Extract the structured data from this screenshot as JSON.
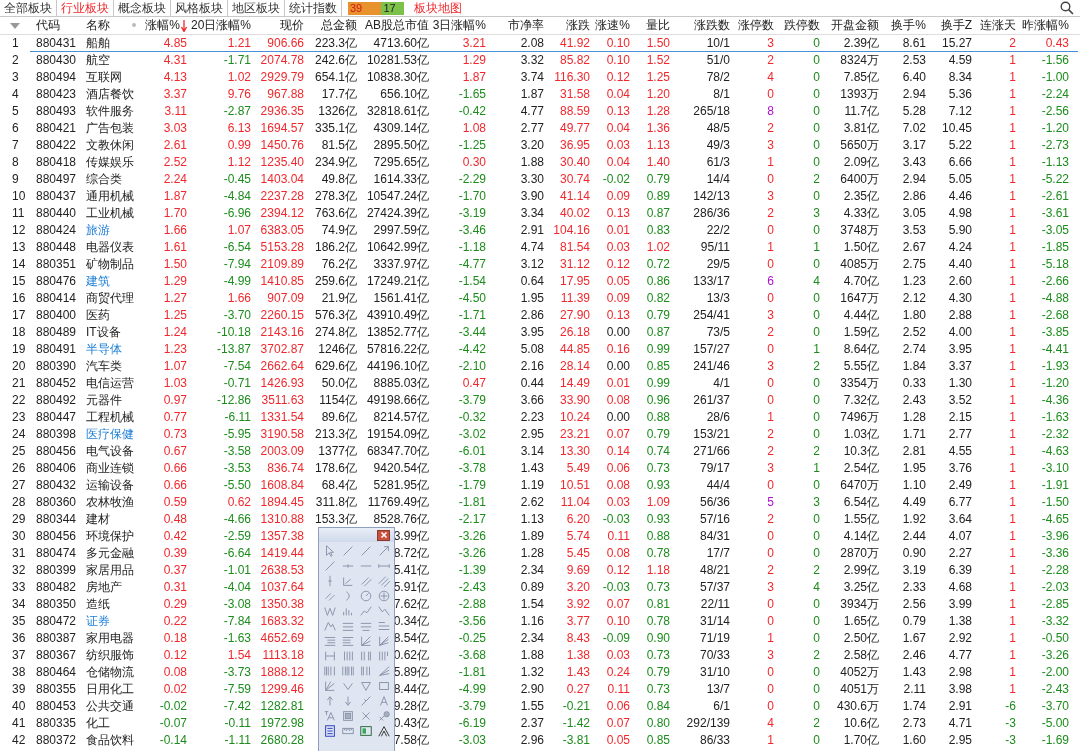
{
  "tabs": [
    {
      "label": "全部板块",
      "selected": false
    },
    {
      "label": "行业板块",
      "selected": true
    },
    {
      "label": "概念板块",
      "selected": false
    },
    {
      "label": "风格板块",
      "selected": false
    },
    {
      "label": "地区板块",
      "selected": false
    },
    {
      "label": "统计指数",
      "selected": false
    }
  ],
  "breadth": {
    "up": "39",
    "down": "17"
  },
  "map_link": "板块地图",
  "columns": [
    {
      "kind": "index"
    },
    {
      "kind": "code",
      "label": "代码",
      "sorted": false
    },
    {
      "kind": "name",
      "label": "名称",
      "sorted": false
    },
    {
      "kind": "change",
      "label": "涨幅%",
      "sorted": true
    },
    {
      "kind": "signed",
      "label": "20日涨幅%",
      "sorted": false
    },
    {
      "kind": "price",
      "label": "现价",
      "sorted": false
    },
    {
      "kind": "plain",
      "label": "总金额",
      "sorted": false
    },
    {
      "kind": "plain",
      "label": "AB股总市值",
      "sorted": false
    },
    {
      "kind": "signed",
      "label": "3日涨幅%",
      "sorted": false
    },
    {
      "kind": "plain",
      "label": "市净率",
      "sorted": false
    },
    {
      "kind": "signed",
      "label": "涨跌",
      "sorted": false
    },
    {
      "kind": "signed",
      "label": "涨速%",
      "sorted": false
    },
    {
      "kind": "ratio",
      "label": "量比",
      "sorted": false
    },
    {
      "kind": "plain",
      "label": "涨跌数",
      "sorted": false
    },
    {
      "kind": "limit_up",
      "label": "涨停数",
      "sorted": false
    },
    {
      "kind": "limit_down",
      "label": "跌停数",
      "sorted": false
    },
    {
      "kind": "plain",
      "label": "开盘金额",
      "sorted": false
    },
    {
      "kind": "plain",
      "label": "换手%",
      "sorted": false
    },
    {
      "kind": "plain",
      "label": "换手Z",
      "sorted": false
    },
    {
      "kind": "signed",
      "label": "连涨天",
      "sorted": false
    },
    {
      "kind": "signed",
      "label": "昨涨幅%",
      "sorted": false
    }
  ],
  "rows": [
    {
      "selected": true,
      "marked": false,
      "cells": [
        "1",
        "880431",
        "船舶",
        "4.85",
        "1.21",
        "906.66",
        "223.3亿",
        "4713.60亿",
        "3.21",
        "2.08",
        "41.92",
        "0.10",
        "1.50",
        "10/1",
        "3",
        "0",
        "2.39亿",
        "8.61",
        "15.27",
        "2",
        "0.43"
      ]
    },
    {
      "selected": false,
      "marked": false,
      "cells": [
        "2",
        "880430",
        "航空",
        "4.31",
        "-1.71",
        "2074.78",
        "242.6亿",
        "10281.53亿",
        "1.29",
        "3.32",
        "85.82",
        "0.10",
        "1.52",
        "51/0",
        "2",
        "0",
        "8324万",
        "2.53",
        "4.59",
        "1",
        "-1.56"
      ]
    },
    {
      "selected": false,
      "marked": false,
      "cells": [
        "3",
        "880494",
        "互联网",
        "4.13",
        "1.02",
        "2929.79",
        "654.1亿",
        "10838.30亿",
        "1.87",
        "3.74",
        "116.30",
        "0.12",
        "1.25",
        "78/2",
        "4",
        "0",
        "7.85亿",
        "6.40",
        "8.34",
        "1",
        "-1.00"
      ]
    },
    {
      "selected": false,
      "marked": false,
      "cells": [
        "4",
        "880423",
        "酒店餐饮",
        "3.37",
        "9.76",
        "967.88",
        "17.7亿",
        "656.10亿",
        "-1.65",
        "1.87",
        "31.58",
        "0.04",
        "1.20",
        "8/1",
        "0",
        "0",
        "1393万",
        "2.94",
        "5.36",
        "1",
        "-2.24"
      ]
    },
    {
      "selected": false,
      "marked": false,
      "cells": [
        "5",
        "880493",
        "软件服务",
        "3.11",
        "-2.87",
        "2936.35",
        "1326亿",
        "32818.61亿",
        "-0.42",
        "4.77",
        "88.59",
        "0.13",
        "1.28",
        "265/18",
        "8",
        "0",
        "11.7亿",
        "5.28",
        "7.12",
        "1",
        "-2.56"
      ]
    },
    {
      "selected": false,
      "marked": false,
      "cells": [
        "6",
        "880421",
        "广告包装",
        "3.03",
        "6.13",
        "1694.57",
        "335.1亿",
        "4309.14亿",
        "1.08",
        "2.77",
        "49.77",
        "0.04",
        "1.36",
        "48/5",
        "2",
        "0",
        "3.81亿",
        "7.02",
        "10.45",
        "1",
        "-1.20"
      ]
    },
    {
      "selected": false,
      "marked": false,
      "cells": [
        "7",
        "880422",
        "文教休闲",
        "2.61",
        "0.99",
        "1450.76",
        "81.5亿",
        "2895.50亿",
        "-1.25",
        "3.20",
        "36.95",
        "0.03",
        "1.13",
        "49/3",
        "3",
        "0",
        "5650万",
        "3.17",
        "5.22",
        "1",
        "-2.73"
      ]
    },
    {
      "selected": false,
      "marked": false,
      "cells": [
        "8",
        "880418",
        "传媒娱乐",
        "2.52",
        "1.12",
        "1235.40",
        "234.9亿",
        "7295.65亿",
        "0.30",
        "1.88",
        "30.40",
        "0.04",
        "1.40",
        "61/3",
        "1",
        "0",
        "2.09亿",
        "3.43",
        "6.66",
        "1",
        "-1.13"
      ]
    },
    {
      "selected": false,
      "marked": false,
      "cells": [
        "9",
        "880497",
        "综合类",
        "2.24",
        "-0.45",
        "1403.04",
        "49.8亿",
        "1614.33亿",
        "-2.29",
        "3.30",
        "30.74",
        "-0.02",
        "0.79",
        "14/4",
        "0",
        "2",
        "6400万",
        "2.94",
        "5.05",
        "1",
        "-5.22"
      ]
    },
    {
      "selected": false,
      "marked": false,
      "cells": [
        "10",
        "880437",
        "通用机械",
        "1.87",
        "-4.84",
        "2237.28",
        "278.3亿",
        "10547.24亿",
        "-1.70",
        "3.90",
        "41.14",
        "0.09",
        "0.89",
        "142/13",
        "3",
        "0",
        "2.35亿",
        "2.86",
        "4.46",
        "1",
        "-2.61"
      ]
    },
    {
      "selected": false,
      "marked": false,
      "cells": [
        "11",
        "880440",
        "工业机械",
        "1.70",
        "-6.96",
        "2394.12",
        "763.6亿",
        "27424.39亿",
        "-3.19",
        "3.34",
        "40.02",
        "0.13",
        "0.87",
        "286/36",
        "2",
        "3",
        "4.33亿",
        "3.05",
        "4.98",
        "1",
        "-3.61"
      ]
    },
    {
      "selected": false,
      "marked": true,
      "cells": [
        "12",
        "880424",
        "旅游",
        "1.66",
        "1.07",
        "6383.05",
        "74.9亿",
        "2997.59亿",
        "-3.46",
        "2.91",
        "104.16",
        "0.01",
        "0.83",
        "22/2",
        "0",
        "0",
        "3748万",
        "3.53",
        "5.90",
        "1",
        "-3.05"
      ]
    },
    {
      "selected": false,
      "marked": false,
      "cells": [
        "13",
        "880448",
        "电器仪表",
        "1.61",
        "-6.54",
        "5153.28",
        "186.2亿",
        "10642.99亿",
        "-1.18",
        "4.74",
        "81.54",
        "0.03",
        "1.02",
        "95/11",
        "1",
        "1",
        "1.50亿",
        "2.67",
        "4.24",
        "1",
        "-1.85"
      ]
    },
    {
      "selected": false,
      "marked": false,
      "cells": [
        "14",
        "880351",
        "矿物制品",
        "1.50",
        "-7.94",
        "2109.89",
        "76.2亿",
        "3337.97亿",
        "-4.77",
        "3.12",
        "31.12",
        "0.12",
        "0.72",
        "29/5",
        "0",
        "0",
        "4085万",
        "2.75",
        "4.40",
        "1",
        "-5.18"
      ]
    },
    {
      "selected": false,
      "marked": true,
      "cells": [
        "15",
        "880476",
        "建筑",
        "1.29",
        "-4.99",
        "1410.85",
        "259.6亿",
        "17249.21亿",
        "-1.54",
        "0.64",
        "17.95",
        "0.05",
        "0.86",
        "133/17",
        "6",
        "4",
        "4.70亿",
        "1.23",
        "2.60",
        "1",
        "-2.66"
      ]
    },
    {
      "selected": false,
      "marked": false,
      "cells": [
        "16",
        "880414",
        "商贸代理",
        "1.27",
        "1.66",
        "907.09",
        "21.9亿",
        "1561.41亿",
        "-4.50",
        "1.95",
        "11.39",
        "0.09",
        "0.82",
        "13/3",
        "0",
        "0",
        "1647万",
        "2.12",
        "4.30",
        "1",
        "-4.88"
      ]
    },
    {
      "selected": false,
      "marked": false,
      "cells": [
        "17",
        "880400",
        "医药",
        "1.25",
        "-3.70",
        "2260.15",
        "576.3亿",
        "43910.49亿",
        "-1.71",
        "2.86",
        "27.90",
        "0.13",
        "0.79",
        "254/41",
        "3",
        "0",
        "4.44亿",
        "1.80",
        "2.88",
        "1",
        "-2.68"
      ]
    },
    {
      "selected": false,
      "marked": false,
      "cells": [
        "18",
        "880489",
        "IT设备",
        "1.24",
        "-10.18",
        "2143.16",
        "274.8亿",
        "13852.77亿",
        "-3.44",
        "3.95",
        "26.18",
        "0.00",
        "0.87",
        "73/5",
        "2",
        "0",
        "1.59亿",
        "2.52",
        "4.00",
        "1",
        "-3.85"
      ]
    },
    {
      "selected": false,
      "marked": true,
      "cells": [
        "19",
        "880491",
        "半导体",
        "1.23",
        "-13.87",
        "3702.87",
        "1246亿",
        "57816.22亿",
        "-4.42",
        "5.08",
        "44.85",
        "0.16",
        "0.99",
        "157/27",
        "0",
        "1",
        "8.64亿",
        "2.74",
        "3.95",
        "1",
        "-4.41"
      ]
    },
    {
      "selected": false,
      "marked": false,
      "cells": [
        "20",
        "880390",
        "汽车类",
        "1.07",
        "-7.54",
        "2662.64",
        "629.6亿",
        "44196.10亿",
        "-2.10",
        "2.16",
        "28.14",
        "0.00",
        "0.85",
        "241/46",
        "3",
        "2",
        "5.55亿",
        "1.84",
        "3.37",
        "1",
        "-1.93"
      ]
    },
    {
      "selected": false,
      "marked": false,
      "cells": [
        "21",
        "880452",
        "电信运营",
        "1.03",
        "-0.71",
        "1426.93",
        "50.0亿",
        "8885.03亿",
        "0.47",
        "0.44",
        "14.49",
        "0.01",
        "0.99",
        "4/1",
        "0",
        "0",
        "3354万",
        "0.33",
        "1.30",
        "1",
        "-1.20"
      ]
    },
    {
      "selected": false,
      "marked": false,
      "cells": [
        "22",
        "880492",
        "元器件",
        "0.97",
        "-12.86",
        "3511.63",
        "1154亿",
        "49198.66亿",
        "-3.79",
        "3.66",
        "33.90",
        "0.08",
        "0.96",
        "261/37",
        "0",
        "0",
        "7.32亿",
        "2.43",
        "3.52",
        "1",
        "-4.36"
      ]
    },
    {
      "selected": false,
      "marked": false,
      "cells": [
        "23",
        "880447",
        "工程机械",
        "0.77",
        "-6.11",
        "1331.54",
        "89.6亿",
        "8214.57亿",
        "-0.32",
        "2.23",
        "10.24",
        "0.00",
        "0.88",
        "28/6",
        "1",
        "0",
        "7496万",
        "1.28",
        "2.15",
        "1",
        "-1.63"
      ]
    },
    {
      "selected": false,
      "marked": true,
      "cells": [
        "24",
        "880398",
        "医疗保健",
        "0.73",
        "-5.95",
        "3190.58",
        "213.3亿",
        "19154.09亿",
        "-3.02",
        "2.95",
        "23.21",
        "0.07",
        "0.79",
        "153/21",
        "2",
        "0",
        "1.03亿",
        "1.71",
        "2.77",
        "1",
        "-2.32"
      ]
    },
    {
      "selected": false,
      "marked": false,
      "cells": [
        "25",
        "880456",
        "电气设备",
        "0.67",
        "-3.58",
        "2003.09",
        "1377亿",
        "68347.70亿",
        "-6.01",
        "3.14",
        "13.30",
        "0.14",
        "0.74",
        "271/66",
        "2",
        "2",
        "10.3亿",
        "2.81",
        "4.55",
        "1",
        "-4.63"
      ]
    },
    {
      "selected": false,
      "marked": false,
      "cells": [
        "26",
        "880406",
        "商业连锁",
        "0.66",
        "-3.53",
        "836.74",
        "178.6亿",
        "9420.54亿",
        "-3.78",
        "1.43",
        "5.49",
        "0.06",
        "0.73",
        "79/17",
        "3",
        "1",
        "2.54亿",
        "1.95",
        "3.76",
        "1",
        "-3.10"
      ]
    },
    {
      "selected": false,
      "marked": false,
      "cells": [
        "27",
        "880432",
        "运输设备",
        "0.66",
        "-5.50",
        "1608.84",
        "68.4亿",
        "5281.95亿",
        "-1.79",
        "1.19",
        "10.51",
        "0.08",
        "0.93",
        "44/4",
        "0",
        "0",
        "6470万",
        "1.10",
        "2.49",
        "1",
        "-1.91"
      ]
    },
    {
      "selected": false,
      "marked": false,
      "cells": [
        "28",
        "880360",
        "农林牧渔",
        "0.59",
        "0.62",
        "1894.45",
        "311.8亿",
        "11769.49亿",
        "-1.81",
        "2.62",
        "11.04",
        "0.03",
        "1.09",
        "56/36",
        "5",
        "3",
        "6.54亿",
        "4.49",
        "6.77",
        "1",
        "-1.50"
      ]
    },
    {
      "selected": false,
      "marked": false,
      "cells": [
        "29",
        "880344",
        "建材",
        "0.48",
        "-4.66",
        "1310.88",
        "153.3亿",
        "8528.76亿",
        "-2.17",
        "1.13",
        "6.20",
        "-0.03",
        "0.93",
        "57/16",
        "2",
        "0",
        "1.55亿",
        "1.92",
        "3.64",
        "1",
        "-4.65"
      ]
    },
    {
      "selected": false,
      "marked": false,
      "cells": [
        "30",
        "880456",
        "环境保护",
        "0.42",
        "-2.59",
        "1357.38",
        null,
        "3.99亿",
        "-3.26",
        "1.89",
        "5.74",
        "0.11",
        "0.88",
        "84/31",
        "0",
        "0",
        "4.14亿",
        "2.44",
        "4.07",
        "1",
        "-3.96"
      ]
    },
    {
      "selected": false,
      "marked": false,
      "cells": [
        "31",
        "880474",
        "多元金融",
        "0.39",
        "-6.64",
        "1419.44",
        null,
        "8.72亿",
        "-3.26",
        "1.28",
        "5.45",
        "0.08",
        "0.78",
        "17/7",
        "0",
        "0",
        "2870万",
        "0.90",
        "2.27",
        "1",
        "-3.36"
      ]
    },
    {
      "selected": false,
      "marked": false,
      "cells": [
        "32",
        "880399",
        "家居用品",
        "0.37",
        "-1.01",
        "2638.53",
        null,
        "5.41亿",
        "-1.39",
        "2.34",
        "9.69",
        "0.12",
        "1.18",
        "48/21",
        "2",
        "2",
        "2.99亿",
        "3.19",
        "6.39",
        "1",
        "-2.28"
      ]
    },
    {
      "selected": false,
      "marked": false,
      "cells": [
        "33",
        "880482",
        "房地产",
        "0.31",
        "-4.04",
        "1037.64",
        null,
        "5.91亿",
        "-2.43",
        "0.89",
        "3.20",
        "-0.03",
        "0.73",
        "57/37",
        "3",
        "4",
        "3.25亿",
        "2.33",
        "4.68",
        "1",
        "-2.03"
      ]
    },
    {
      "selected": false,
      "marked": false,
      "cells": [
        "34",
        "880350",
        "造纸",
        "0.29",
        "-3.08",
        "1350.38",
        null,
        "7.62亿",
        "-2.88",
        "1.54",
        "3.92",
        "0.07",
        "0.81",
        "22/11",
        "0",
        "0",
        "3934万",
        "2.56",
        "3.99",
        "1",
        "-2.85"
      ]
    },
    {
      "selected": false,
      "marked": true,
      "cells": [
        "35",
        "880472",
        "证券",
        "0.22",
        "-7.84",
        "1683.32",
        null,
        "0.34亿",
        "-3.56",
        "1.16",
        "3.77",
        "0.10",
        "0.78",
        "31/14",
        "0",
        "0",
        "1.65亿",
        "0.79",
        "1.38",
        "1",
        "-3.32"
      ]
    },
    {
      "selected": false,
      "marked": false,
      "cells": [
        "36",
        "880387",
        "家用电器",
        "0.18",
        "-1.63",
        "4652.69",
        null,
        "8.54亿",
        "-0.25",
        "2.34",
        "8.43",
        "-0.09",
        "0.90",
        "71/19",
        "1",
        "0",
        "2.50亿",
        "1.67",
        "2.92",
        "1",
        "-0.50"
      ]
    },
    {
      "selected": false,
      "marked": false,
      "cells": [
        "37",
        "880367",
        "纺织服饰",
        "0.12",
        "1.54",
        "1113.18",
        null,
        "0.62亿",
        "-3.68",
        "1.88",
        "1.38",
        "0.03",
        "0.73",
        "70/33",
        "3",
        "2",
        "2.58亿",
        "2.46",
        "4.77",
        "1",
        "-3.26"
      ]
    },
    {
      "selected": false,
      "marked": false,
      "cells": [
        "38",
        "880464",
        "仓储物流",
        "0.08",
        "-3.73",
        "1888.12",
        null,
        "5.89亿",
        "-1.81",
        "1.32",
        "1.43",
        "0.24",
        "0.79",
        "31/10",
        "0",
        "0",
        "4052万",
        "1.43",
        "2.98",
        "1",
        "-2.00"
      ]
    },
    {
      "selected": false,
      "marked": false,
      "cells": [
        "39",
        "880355",
        "日用化工",
        "0.02",
        "-7.59",
        "1299.46",
        null,
        "8.44亿",
        "-4.99",
        "2.90",
        "0.27",
        "0.11",
        "0.73",
        "13/7",
        "0",
        "0",
        "4051万",
        "2.11",
        "3.98",
        "1",
        "-2.43"
      ]
    },
    {
      "selected": false,
      "marked": false,
      "cells": [
        "40",
        "880453",
        "公共交通",
        "-0.02",
        "-7.42",
        "1282.81",
        null,
        "9.28亿",
        "-3.79",
        "1.55",
        "-0.21",
        "0.06",
        "0.84",
        "6/1",
        "0",
        "0",
        "430.6万",
        "1.74",
        "2.91",
        "-6",
        "-3.70"
      ]
    },
    {
      "selected": false,
      "marked": false,
      "cells": [
        "41",
        "880335",
        "化工",
        "-0.07",
        "-0.11",
        "1972.98",
        null,
        "0.43亿",
        "-6.19",
        "2.37",
        "-1.42",
        "0.07",
        "0.80",
        "292/139",
        "4",
        "2",
        "10.6亿",
        "2.73",
        "4.71",
        "-3",
        "-5.00"
      ]
    },
    {
      "selected": false,
      "marked": false,
      "cells": [
        "42",
        "880372",
        "食品饮料",
        "-0.14",
        "-1.11",
        "2680.28",
        null,
        "7.58亿",
        "-3.03",
        "2.96",
        "-3.81",
        "0.05",
        "0.85",
        "86/33",
        "1",
        "0",
        "1.70亿",
        "1.60",
        "2.95",
        "-3",
        "-1.69"
      ]
    }
  ]
}
